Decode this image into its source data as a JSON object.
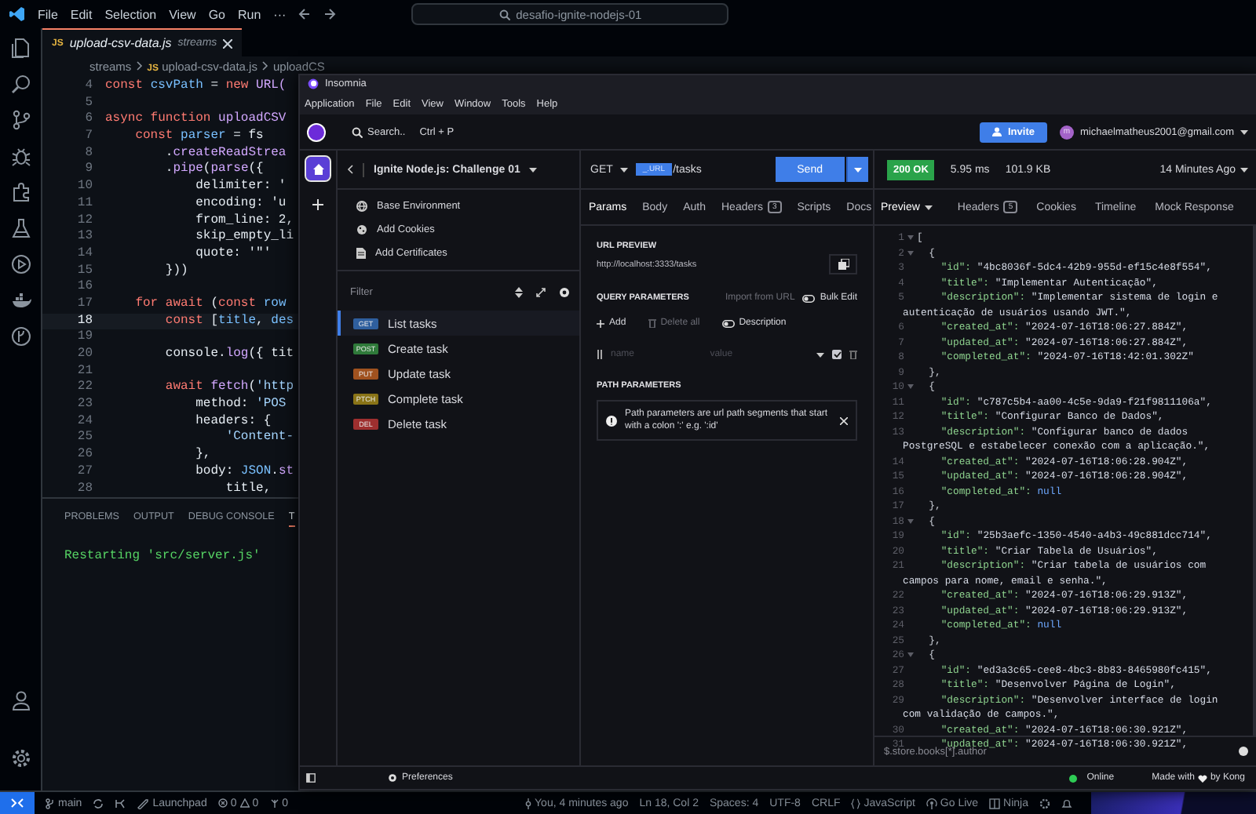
{
  "vscode": {
    "menu": [
      "File",
      "Edit",
      "Selection",
      "View",
      "Go",
      "Run",
      "···"
    ],
    "search": "desafio-ignite-nodejs-01",
    "tab": {
      "badge": "JS",
      "filename": "upload-csv-data.js",
      "folder": "streams"
    },
    "breadcrumbs": [
      {
        "text": "streams"
      },
      {
        "badge": "JS",
        "text": "upload-csv-data.js"
      },
      {
        "text": "uploadCS"
      }
    ],
    "code_lines": [
      {
        "number": "4",
        "current": false,
        "parts": [
          {
            "kind": "kw",
            "text": "const "
          },
          {
            "kind": "var",
            "text": "csvPath"
          },
          {
            "kind": "plain",
            "text": " = "
          },
          {
            "kind": "kw",
            "text": "new "
          },
          {
            "kind": "fn",
            "text": "URL("
          }
        ]
      },
      {
        "number": "5",
        "current": false
      },
      {
        "number": "6",
        "current": false,
        "parts": [
          {
            "kind": "kw",
            "text": "async function "
          },
          {
            "kind": "fn",
            "text": "uploadCSV"
          }
        ]
      },
      {
        "number": "7",
        "current": false,
        "parts": [
          {
            "kind": "kw",
            "text": "    const "
          },
          {
            "kind": "var",
            "text": "parser"
          },
          {
            "kind": "plain",
            "text": " = fs"
          }
        ]
      },
      {
        "number": "8",
        "current": false,
        "parts": [
          {
            "kind": "plain",
            "text": "        ."
          },
          {
            "kind": "fn",
            "text": "createReadStrea"
          }
        ]
      },
      {
        "number": "9",
        "current": false,
        "parts": [
          {
            "kind": "plain",
            "text": "        ."
          },
          {
            "kind": "fn",
            "text": "pipe"
          },
          {
            "kind": "plain",
            "text": "("
          },
          {
            "kind": "fn",
            "text": "parse"
          },
          {
            "kind": "plain",
            "text": "({"
          }
        ]
      },
      {
        "number": "10",
        "current": false,
        "parts": [
          {
            "kind": "plain",
            "text": "            delimiter: '"
          }
        ]
      },
      {
        "number": "11",
        "current": false,
        "parts": [
          {
            "kind": "plain",
            "text": "            encoding: 'u"
          }
        ]
      },
      {
        "number": "12",
        "current": false,
        "parts": [
          {
            "kind": "plain",
            "text": "            from_line: 2,"
          }
        ]
      },
      {
        "number": "13",
        "current": false,
        "parts": [
          {
            "kind": "plain",
            "text": "            skip_empty_li"
          }
        ]
      },
      {
        "number": "14",
        "current": false,
        "parts": [
          {
            "kind": "plain",
            "text": "            quote: '\"'"
          }
        ]
      },
      {
        "number": "15",
        "current": false,
        "parts": [
          {
            "kind": "plain",
            "text": "        }))"
          }
        ]
      },
      {
        "number": "16",
        "current": false
      },
      {
        "number": "17",
        "current": false,
        "parts": [
          {
            "kind": "kw",
            "text": "    for await "
          },
          {
            "kind": "plain",
            "text": "("
          },
          {
            "kind": "kw",
            "text": "const "
          },
          {
            "kind": "var",
            "text": "row"
          }
        ]
      },
      {
        "number": "18",
        "current": true,
        "parts": [
          {
            "kind": "kw",
            "text": "        const "
          },
          {
            "kind": "plain",
            "text": "["
          },
          {
            "kind": "var",
            "text": "title"
          },
          {
            "kind": "plain",
            "text": ", "
          },
          {
            "kind": "var",
            "text": "des"
          }
        ]
      },
      {
        "number": "19",
        "current": false
      },
      {
        "number": "20",
        "current": false,
        "parts": [
          {
            "kind": "plain",
            "text": "        console."
          },
          {
            "kind": "fn",
            "text": "log"
          },
          {
            "kind": "plain",
            "text": "({ tit"
          }
        ]
      },
      {
        "number": "21",
        "current": false
      },
      {
        "number": "22",
        "current": false,
        "parts": [
          {
            "kind": "kw",
            "text": "        await "
          },
          {
            "kind": "fn",
            "text": "fetch"
          },
          {
            "kind": "plain",
            "text": "("
          },
          {
            "kind": "str",
            "text": "'http"
          }
        ]
      },
      {
        "number": "23",
        "current": false,
        "parts": [
          {
            "kind": "plain",
            "text": "            method: "
          },
          {
            "kind": "str",
            "text": "'POS"
          }
        ]
      },
      {
        "number": "24",
        "current": false,
        "parts": [
          {
            "kind": "plain",
            "text": "            headers: {"
          }
        ]
      },
      {
        "number": "25",
        "current": false,
        "parts": [
          {
            "kind": "str",
            "text": "                'Content-"
          }
        ]
      },
      {
        "number": "26",
        "current": false,
        "parts": [
          {
            "kind": "plain",
            "text": "            },"
          }
        ]
      },
      {
        "number": "27",
        "current": false,
        "parts": [
          {
            "kind": "plain",
            "text": "            body: "
          },
          {
            "kind": "var",
            "text": "JSON"
          },
          {
            "kind": "plain",
            "text": "."
          },
          {
            "kind": "fn",
            "text": "st"
          }
        ]
      },
      {
        "number": "28",
        "current": false,
        "parts": [
          {
            "kind": "plain",
            "text": "                title,"
          }
        ]
      }
    ],
    "panel_tabs": [
      {
        "label": "PROBLEMS",
        "selected": false
      },
      {
        "label": "OUTPUT",
        "selected": false
      },
      {
        "label": "DEBUG CONSOLE",
        "selected": false
      },
      {
        "label": "T",
        "selected": true
      }
    ],
    "terminal_output": "Restarting 'src/server.js'",
    "status_bar": {
      "branch": "main",
      "launchpad": "Launchpad",
      "errors": "0",
      "warnings": "0",
      "ports": "0",
      "blame": "You, 4 minutes ago",
      "position": "Ln 18, Col 2",
      "spaces": "Spaces: 4",
      "encoding": "UTF-8",
      "eol": "CRLF",
      "language": "JavaScript",
      "go_live": "Go Live",
      "ninja": "Ninja"
    }
  },
  "insomnia": {
    "title": "Insomnia",
    "menu": [
      "Application",
      "File",
      "Edit",
      "View",
      "Window",
      "Tools",
      "Help"
    ],
    "search": "Search..",
    "shortcut": "Ctrl + P",
    "invite": "Invite",
    "avatar": "m",
    "email": "michaelmatheus2001@gmail.com",
    "nav": [
      {
        "kind": "home",
        "selected": true
      },
      {
        "kind": "add",
        "selected": false
      }
    ],
    "project": "Ignite Node.js: Challenge 01",
    "sidebar_links": [
      {
        "kind": "globe",
        "label": "Base Environment"
      },
      {
        "kind": "cookie",
        "label": "Add Cookies"
      },
      {
        "kind": "certificate",
        "label": "Add Certificates"
      }
    ],
    "filter_placeholder": "Filter",
    "requests": [
      {
        "method": "GET",
        "name": "List tasks",
        "color": "#2f5f9e",
        "selected": true
      },
      {
        "method": "POST",
        "name": "Create task",
        "color": "#2f7a3a",
        "selected": false
      },
      {
        "method": "PUT",
        "name": "Update task",
        "color": "#a0521f",
        "selected": false
      },
      {
        "method": "PTCH",
        "name": "Complete task",
        "color": "#8a7417",
        "selected": false
      },
      {
        "method": "DEL",
        "name": "Delete task",
        "color": "#9e2f2f",
        "selected": false
      }
    ],
    "preferences": "Preferences",
    "request": {
      "method": "GET",
      "url_tag": "_.URL",
      "url_path": "/tasks",
      "send": "Send",
      "tabs": [
        {
          "label": "Params",
          "selected": true
        },
        {
          "label": "Body",
          "selected": false
        },
        {
          "label": "Auth",
          "selected": false
        },
        {
          "label": "Headers",
          "count": "3",
          "selected": false
        },
        {
          "label": "Scripts",
          "selected": false
        },
        {
          "label": "Docs",
          "selected": false
        }
      ],
      "url_preview_label": "URL PREVIEW",
      "url_preview": "http://localhost:3333/tasks",
      "query_label": "QUERY PARAMETERS",
      "import": "Import from URL",
      "bulk_edit": "Bulk Edit",
      "add": "Add",
      "delete_all": "Delete all",
      "description": "Description",
      "param_row": {
        "name_placeholder": "name",
        "value_placeholder": "value",
        "enabled": true
      },
      "path_label": "PATH PARAMETERS",
      "path_info": "Path parameters are url path segments that start with a colon ':' e.g. ':id'"
    },
    "response": {
      "status": "200 OK",
      "time": "5.95 ms",
      "size": "101.9 KB",
      "age": "14 Minutes Ago",
      "tabs": [
        {
          "label": "Preview",
          "selected": true
        },
        {
          "label": "Headers",
          "count": "5",
          "selected": false
        },
        {
          "label": "Cookies",
          "selected": false
        },
        {
          "label": "Timeline",
          "selected": false
        },
        {
          "label": "Mock Response",
          "selected": false
        }
      ],
      "lines": [
        {
          "number": "1",
          "fold": true,
          "parts": [
            {
              "kind": "punct",
              "text": "["
            }
          ]
        },
        {
          "number": "2",
          "fold": true,
          "parts": [
            {
              "kind": "punct",
              "text": "  {"
            }
          ]
        },
        {
          "number": "3",
          "parts": [
            {
              "kind": "key",
              "text": "    \"id\": "
            },
            {
              "kind": "str",
              "text": "\"4bc8036f-5dc4-42b9-955d-ef15c4e8f554\","
            }
          ]
        },
        {
          "number": "4",
          "parts": [
            {
              "kind": "key",
              "text": "    \"title\": "
            },
            {
              "kind": "str",
              "text": "\"Implementar Autenticação\","
            }
          ]
        },
        {
          "number": "5",
          "parts": [
            {
              "kind": "key",
              "text": "    \"description\": "
            },
            {
              "kind": "str",
              "text": "\"Implementar sistema de login e"
            }
          ]
        },
        {
          "parts": [
            {
              "kind": "str",
              "text": "autenticação de usuários usando JWT.\","
            }
          ]
        },
        {
          "number": "6",
          "parts": [
            {
              "kind": "key",
              "text": "    \"created_at\": "
            },
            {
              "kind": "str",
              "text": "\"2024-07-16T18:06:27.884Z\","
            }
          ]
        },
        {
          "number": "7",
          "parts": [
            {
              "kind": "key",
              "text": "    \"updated_at\": "
            },
            {
              "kind": "str",
              "text": "\"2024-07-16T18:06:27.884Z\","
            }
          ]
        },
        {
          "number": "8",
          "parts": [
            {
              "kind": "key",
              "text": "    \"completed_at\": "
            },
            {
              "kind": "str",
              "text": "\"2024-07-16T18:42:01.302Z\""
            }
          ]
        },
        {
          "number": "9",
          "parts": [
            {
              "kind": "punct",
              "text": "  },"
            }
          ]
        },
        {
          "number": "10",
          "fold": true,
          "parts": [
            {
              "kind": "punct",
              "text": "  {"
            }
          ]
        },
        {
          "number": "11",
          "parts": [
            {
              "kind": "key",
              "text": "    \"id\": "
            },
            {
              "kind": "str",
              "text": "\"c787c5b4-aa00-4c5e-9da9-f21f9811106a\","
            }
          ]
        },
        {
          "number": "12",
          "parts": [
            {
              "kind": "key",
              "text": "    \"title\": "
            },
            {
              "kind": "str",
              "text": "\"Configurar Banco de Dados\","
            }
          ]
        },
        {
          "number": "13",
          "parts": [
            {
              "kind": "key",
              "text": "    \"description\": "
            },
            {
              "kind": "str",
              "text": "\"Configurar banco de dados"
            }
          ]
        },
        {
          "parts": [
            {
              "kind": "str",
              "text": "PostgreSQL e estabelecer conexão com a aplicação.\","
            }
          ]
        },
        {
          "number": "14",
          "parts": [
            {
              "kind": "key",
              "text": "    \"created_at\": "
            },
            {
              "kind": "str",
              "text": "\"2024-07-16T18:06:28.904Z\","
            }
          ]
        },
        {
          "number": "15",
          "parts": [
            {
              "kind": "key",
              "text": "    \"updated_at\": "
            },
            {
              "kind": "str",
              "text": "\"2024-07-16T18:06:28.904Z\","
            }
          ]
        },
        {
          "number": "16",
          "parts": [
            {
              "kind": "key",
              "text": "    \"completed_at\": "
            },
            {
              "kind": "null",
              "text": "null"
            }
          ]
        },
        {
          "number": "17",
          "parts": [
            {
              "kind": "punct",
              "text": "  },"
            }
          ]
        },
        {
          "number": "18",
          "fold": true,
          "parts": [
            {
              "kind": "punct",
              "text": "  {"
            }
          ]
        },
        {
          "number": "19",
          "parts": [
            {
              "kind": "key",
              "text": "    \"id\": "
            },
            {
              "kind": "str",
              "text": "\"25b3aefc-1350-4540-a4b3-49c881dcc714\","
            }
          ]
        },
        {
          "number": "20",
          "parts": [
            {
              "kind": "key",
              "text": "    \"title\": "
            },
            {
              "kind": "str",
              "text": "\"Criar Tabela de Usuários\","
            }
          ]
        },
        {
          "number": "21",
          "parts": [
            {
              "kind": "key",
              "text": "    \"description\": "
            },
            {
              "kind": "str",
              "text": "\"Criar tabela de usuários com"
            }
          ]
        },
        {
          "parts": [
            {
              "kind": "str",
              "text": "campos para nome, email e senha.\","
            }
          ]
        },
        {
          "number": "22",
          "parts": [
            {
              "kind": "key",
              "text": "    \"created_at\": "
            },
            {
              "kind": "str",
              "text": "\"2024-07-16T18:06:29.913Z\","
            }
          ]
        },
        {
          "number": "23",
          "parts": [
            {
              "kind": "key",
              "text": "    \"updated_at\": "
            },
            {
              "kind": "str",
              "text": "\"2024-07-16T18:06:29.913Z\","
            }
          ]
        },
        {
          "number": "24",
          "parts": [
            {
              "kind": "key",
              "text": "    \"completed_at\": "
            },
            {
              "kind": "null",
              "text": "null"
            }
          ]
        },
        {
          "number": "25",
          "parts": [
            {
              "kind": "punct",
              "text": "  },"
            }
          ]
        },
        {
          "number": "26",
          "fold": true,
          "parts": [
            {
              "kind": "punct",
              "text": "  {"
            }
          ]
        },
        {
          "number": "27",
          "parts": [
            {
              "kind": "key",
              "text": "    \"id\": "
            },
            {
              "kind": "str",
              "text": "\"ed3a3c65-cee8-4bc3-8b83-8465980fc415\","
            }
          ]
        },
        {
          "number": "28",
          "parts": [
            {
              "kind": "key",
              "text": "    \"title\": "
            },
            {
              "kind": "str",
              "text": "\"Desenvolver Página de Login\","
            }
          ]
        },
        {
          "number": "29",
          "parts": [
            {
              "kind": "key",
              "text": "    \"description\": "
            },
            {
              "kind": "str",
              "text": "\"Desenvolver interface de login"
            }
          ]
        },
        {
          "parts": [
            {
              "kind": "str",
              "text": "com validação de campos.\","
            }
          ]
        },
        {
          "number": "30",
          "parts": [
            {
              "kind": "key",
              "text": "    \"created_at\": "
            },
            {
              "kind": "str",
              "text": "\"2024-07-16T18:06:30.921Z\","
            }
          ]
        },
        {
          "number": "31",
          "parts": [
            {
              "kind": "key",
              "text": "    \"updated_at\": "
            },
            {
              "kind": "str",
              "text": "\"2024-07-16T18:06:30.921Z\","
            }
          ]
        }
      ],
      "filter_placeholder": "$.store.books[*].author"
    },
    "online": "Online",
    "made_with": "Made with",
    "by": "by Kong"
  }
}
